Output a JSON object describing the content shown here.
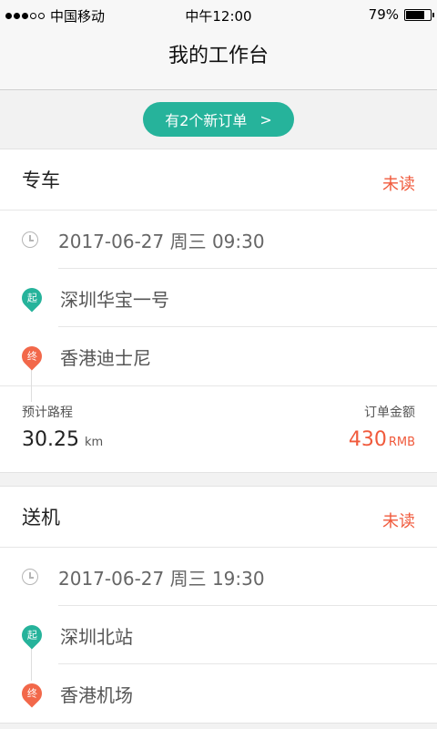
{
  "status_bar": {
    "carrier": "中国移动",
    "time": "中午12:00",
    "battery": "79%",
    "battery_level": 0.79,
    "signal": {
      "filled": 3,
      "empty": 2
    }
  },
  "nav": {
    "title": "我的工作台"
  },
  "banner": {
    "label": "有2个新订单"
  },
  "orders": [
    {
      "type": "专车",
      "status": "未读",
      "datetime": "2017-06-27  周三  09:30",
      "start_badge": "起",
      "start": "深圳华宝一号",
      "end_badge": "终",
      "end": "香港迪士尼",
      "distance_label": "预计路程",
      "distance": "30.25",
      "distance_unit": "km",
      "amount_label": "订单金额",
      "amount": "430",
      "amount_unit": "RMB"
    },
    {
      "type": "送机",
      "status": "未读",
      "datetime": "2017-06-27  周三  19:30",
      "start_badge": "起",
      "start": "深圳北站",
      "end_badge": "终",
      "end": "香港机场"
    }
  ],
  "colors": {
    "accent": "#26b39b",
    "alert": "#f05a3c"
  }
}
